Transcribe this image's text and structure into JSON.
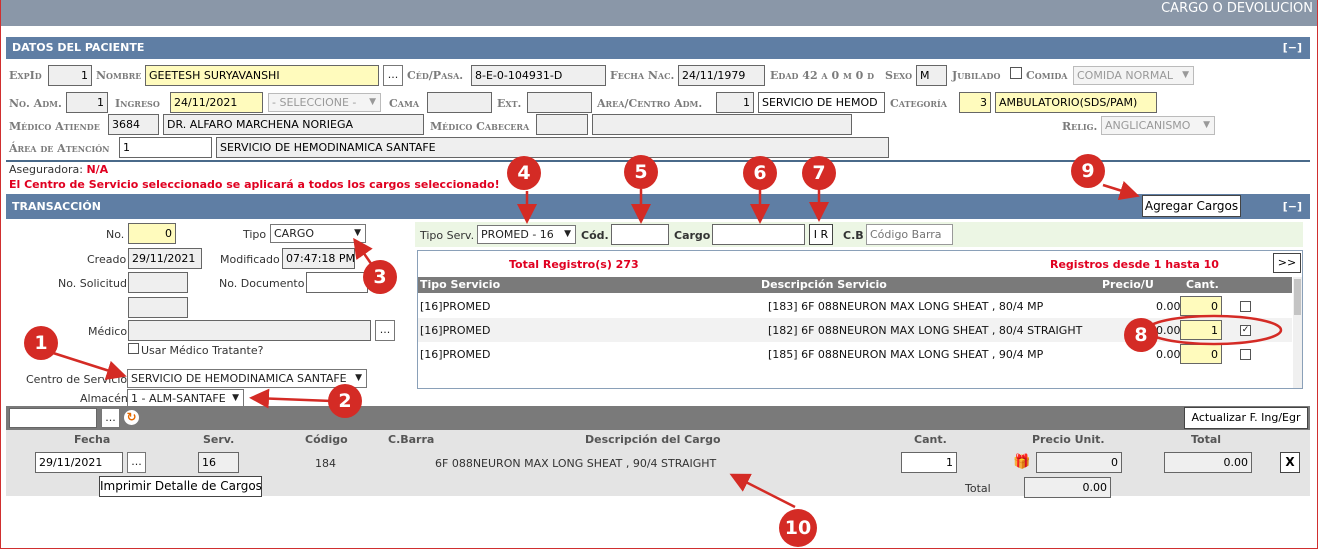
{
  "window": {
    "title": "CARGO O DEVOLUCION"
  },
  "patient": {
    "header": "DATOS DEL PACIENTE",
    "collapse": "[−]",
    "expid_label": "ExpId",
    "expid": "1",
    "nombre_label": "Nombre",
    "nombre": "GEETESH SURYAVANSHI",
    "lookup_btn": "...",
    "ced_label": "Céd/Pasa.",
    "ced": "8-E-0-104931-D",
    "fecha_nac_label": "Fecha Nac.",
    "fecha_nac": "24/11/1979",
    "edad_label": "Edad 42 a 0 m 0 d",
    "sexo_label": "Sexo",
    "sexo": "M",
    "jubilado_label": "Jubilado",
    "comida_label": "Comida",
    "comida": "COMIDA NORMAL",
    "no_adm_label": "No. Adm.",
    "no_adm": "1",
    "ingreso_label": "Ingreso",
    "ingreso": "24/11/2021",
    "seleccione": "- SELECCIONE -",
    "cama_label": "Cama",
    "ext_label": "Ext.",
    "area_centro_label": "Area/Centro Adm.",
    "area_centro_code": "1",
    "area_centro": "SERVICIO DE HEMOD",
    "categoria_label": "Categoría",
    "categoria_code": "3",
    "categoria": "AMBULATORIO(SDS/PAM)",
    "medico_atiende_label": "Médico Atiende",
    "medico_code": "3684",
    "medico": "DR. ALFARO MARCHENA NORIEGA",
    "medico_cabecera_label": "Médico Cabecera",
    "relig_label": "Relig.",
    "relig": "ANGLICANISMO",
    "area_atencion_label": "Área de Atención",
    "area_atencion_code": "1",
    "area_atencion": "SERVICIO DE HEMODINAMICA SANTAFE",
    "aseguradora_label": "Aseguradora:",
    "aseguradora": "N/A",
    "warning": "El Centro de Servicio seleccionado se aplicará a todos los cargos seleccionado!"
  },
  "transaction": {
    "header": "TRANSACCIÓN",
    "collapse": "[−]",
    "add_button": "Agregar Cargos",
    "no_label": "No.",
    "no": "0",
    "tipo_label": "Tipo",
    "tipo": "CARGO",
    "creado_label": "Creado",
    "creado": "29/11/2021",
    "modificado_label": "Modificado",
    "modificado": "07:47:18 PM",
    "no_solicitud_label": "No. Solicitud",
    "no_documento_label": "No. Documento",
    "medico_label": "Médico",
    "usar_medico_label": "Usar Médico Tratante?",
    "centro_servicio_label": "Centro de Servicio",
    "centro_servicio": "SERVICIO DE HEMODINAMICA SANTAFE",
    "almacen_label": "Almacén",
    "almacen": "1 - ALM-SANTAFE"
  },
  "search": {
    "tipo_serv_label": "Tipo Serv.",
    "tipo_serv": "PROMED - 16",
    "cod_label": "Cód.",
    "cargo_label": "Cargo",
    "ir_btn": "I R",
    "cb_label": "C.B",
    "cb_placeholder": "Código Barra",
    "total_registros": "Total Registro(s) 273",
    "registros_rango": "Registros desde 1 hasta 10",
    "next_btn": ">>",
    "columns": [
      "Tipo Servicio",
      "Descripción Servicio",
      "Precio/U",
      "Cant."
    ],
    "rows": [
      {
        "tipo": "[16]PROMED",
        "desc": "[183] 6F 088NEURON MAX LONG SHEAT , 80/4 MP",
        "precio": "0.00",
        "cant": "0",
        "checked": ""
      },
      {
        "tipo": "[16]PROMED",
        "desc": "[182] 6F 088NEURON MAX LONG SHEAT , 80/4 STRAIGHT",
        "precio": "0.00",
        "cant": "1",
        "checked": "✓"
      },
      {
        "tipo": "[16]PROMED",
        "desc": "[185] 6F 088NEURON MAX LONG SHEAT , 90/4 MP",
        "precio": "0.00",
        "cant": "0",
        "checked": ""
      }
    ]
  },
  "charges": {
    "lookup_btn": "...",
    "refresh_icon": "↻",
    "actualizar_btn": "Actualizar F. Ing/Egr",
    "columns": [
      "Fecha",
      "Serv.",
      "Código",
      "C.Barra",
      "Descripción del Cargo",
      "Cant.",
      "Precio Unit.",
      "Total"
    ],
    "row": {
      "fecha": "29/11/2021",
      "serv": "16",
      "codigo": "184",
      "desc": "6F 088NEURON MAX LONG SHEAT , 90/4 STRAIGHT",
      "cant": "1",
      "precio": "0",
      "total": "0.00",
      "remove": "X"
    },
    "imprimir_btn": "Imprimir Detalle de Cargos",
    "total_label": "Total",
    "total": "0.00"
  },
  "annotations": [
    "1",
    "2",
    "3",
    "4",
    "5",
    "6",
    "7",
    "8",
    "9",
    "10"
  ],
  "colors": {
    "section_header": "#5f7ea4",
    "marker": "#d42b25",
    "highlight_input": "#fffbbd",
    "alert_text": "#e00020"
  }
}
